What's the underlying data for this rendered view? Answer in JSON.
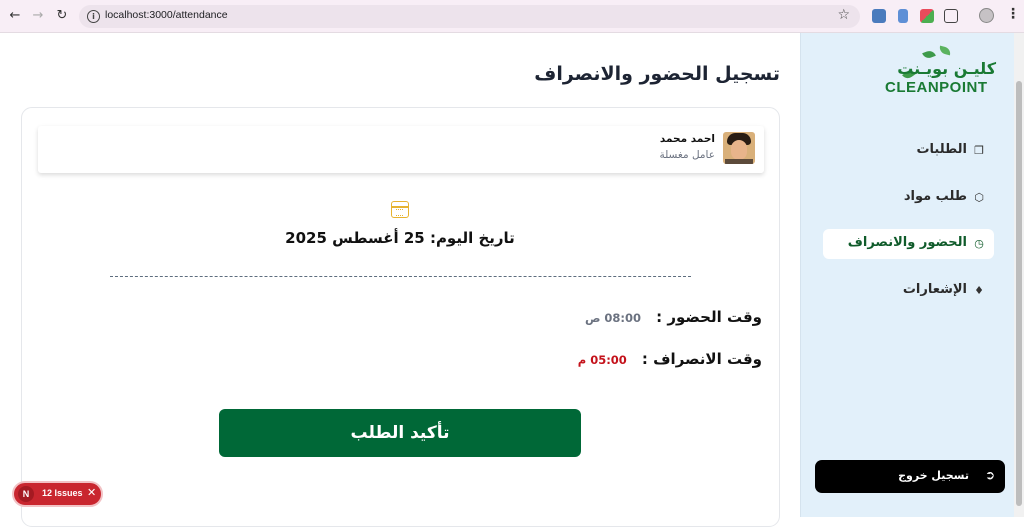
{
  "browser": {
    "url": "localhost:3000/attendance"
  },
  "sidebar": {
    "logo_ar": "كليـن بويـنت",
    "logo_en": "CLEANPOINT",
    "items": [
      {
        "label": "الطلبات",
        "icon": "orders-icon",
        "active": false
      },
      {
        "label": "طلب مواد",
        "icon": "box-icon",
        "active": false
      },
      {
        "label": "الحضور والانصراف",
        "icon": "clock-icon",
        "active": true
      },
      {
        "label": "الإشعارات",
        "icon": "bell-icon",
        "active": false
      }
    ],
    "logout_label": "تسجيل خروج"
  },
  "main": {
    "title": "تسجيل الحضور والانصراف",
    "employee": {
      "name": "احمد محمد",
      "role": "عامل مغسلة"
    },
    "date_label": "تاريخ اليوم: 25 أغسطس 2025",
    "check_in_label": "وقت الحضور :",
    "check_in_value": "08:00 ص",
    "check_out_label": "وقت الانصراف :",
    "check_out_value": "05:00 م",
    "confirm_label": "تأكيد الطلب"
  },
  "devtools": {
    "issues_label": "12 Issues",
    "badge": "N"
  },
  "colors": {
    "brand_green": "#006837",
    "sidebar_bg": "#e2f0fa",
    "checkout_red": "#c4121b",
    "calendar_yellow": "#e7b32f"
  }
}
